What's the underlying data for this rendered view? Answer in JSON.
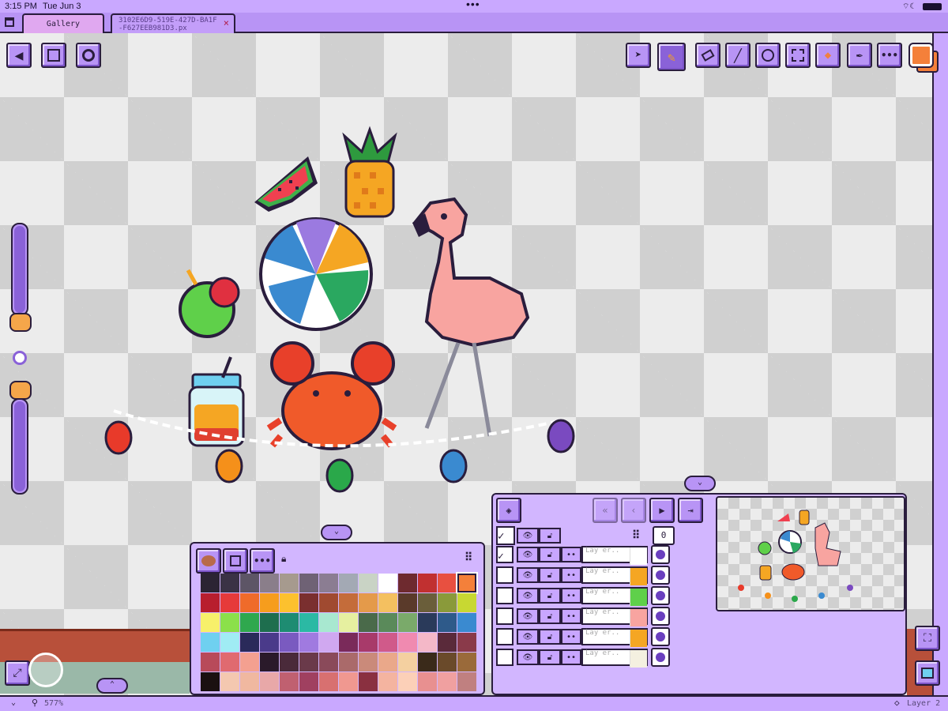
{
  "status": {
    "time": "3:15 PM",
    "date": "Tue Jun 3",
    "battery": "100%"
  },
  "tabs": [
    {
      "label": "Gallery"
    },
    {
      "label": "3102E6D9-519E-427D-BA1F-F627EEB981D3.px",
      "close": "×"
    }
  ],
  "toolbar_left": [
    "back-icon",
    "save-icon",
    "settings-icon"
  ],
  "toolbar_right": [
    "cursor-icon",
    "pencil-icon",
    "eraser-icon",
    "line-icon",
    "circle-icon",
    "selection-icon",
    "fill-icon",
    "eyedropper-icon",
    "more-icon"
  ],
  "colors": {
    "accent": "#c9a8ff",
    "primary": "#f4803a",
    "secondary": "#f4803a",
    "outline": "#2a1d3d"
  },
  "palette_panel": {
    "buttons": [
      "palette-icon",
      "save-icon",
      "more-icon"
    ],
    "lock": "lock-icon",
    "swatches": [
      "#2b2433",
      "#3a3245",
      "#5d5566",
      "#8a7e8a",
      "#a69a8e",
      "#6f6275",
      "#8b7d92",
      "#a3a9b4",
      "#c9d3c5",
      "#ffffff",
      "#6e2a2f",
      "#c13030",
      "#e85040",
      "#f4803a",
      "#b81e2e",
      "#e63a3a",
      "#ef6b2a",
      "#f69d1d",
      "#fcc12e",
      "#7a2f2f",
      "#a04a30",
      "#c46c3a",
      "#e49a4a",
      "#f4c060",
      "#5a3a2a",
      "#6a5e3a",
      "#8a9a3a",
      "#c8d832",
      "#f7f06a",
      "#8be04a",
      "#2fa84e",
      "#1e6e4e",
      "#1e8c72",
      "#2bb9a4",
      "#a8e8d0",
      "#e6f0a0",
      "#4a6a4a",
      "#5a8a5a",
      "#7aaa6a",
      "#2a3a5a",
      "#2e5a8a",
      "#3a8ad0",
      "#6fd0f0",
      "#a0ecf4",
      "#2a2a5a",
      "#4a3a8a",
      "#7a5ac0",
      "#a07ae0",
      "#d0a8f0",
      "#7a2a5a",
      "#a83a6a",
      "#d05a8a",
      "#f08ab0",
      "#f4b8c8",
      "#5a2a3a",
      "#8a3a4a",
      "#b84a5a",
      "#e06a70",
      "#f4a090",
      "#2a1a2a",
      "#4a2a3a",
      "#6a3a4a",
      "#8a4a5a",
      "#aa6a6a",
      "#ca8a7a",
      "#eaa88a",
      "#f4d0a0",
      "#3a2a1a",
      "#6a4a2a",
      "#9a6a3a",
      "#1a1010",
      "#f4c8b0",
      "#f0b8a0",
      "#e8a8a8",
      "#c06070",
      "#a04060",
      "#d87070",
      "#f09890",
      "#8a3040",
      "#f4b4a0",
      "#fcd0b8",
      "#e89090",
      "#f0a0a0",
      "#c08080"
    ]
  },
  "layers_panel": {
    "frame_count": "0",
    "nav": [
      "first-frame-icon",
      "prev-frame-icon",
      "play-icon",
      "next-frame-icon"
    ],
    "layers": [
      {
        "label": "Lay er..",
        "selected": true
      },
      {
        "label": "Lay er..",
        "selected": false
      },
      {
        "label": "Lay er..",
        "selected": false
      },
      {
        "label": "Lay er..",
        "selected": false
      },
      {
        "label": "Lay er..",
        "selected": false
      },
      {
        "label": "Lay er..",
        "selected": false
      }
    ]
  },
  "footer": {
    "zoom": "577%",
    "layer": "Layer 2"
  }
}
